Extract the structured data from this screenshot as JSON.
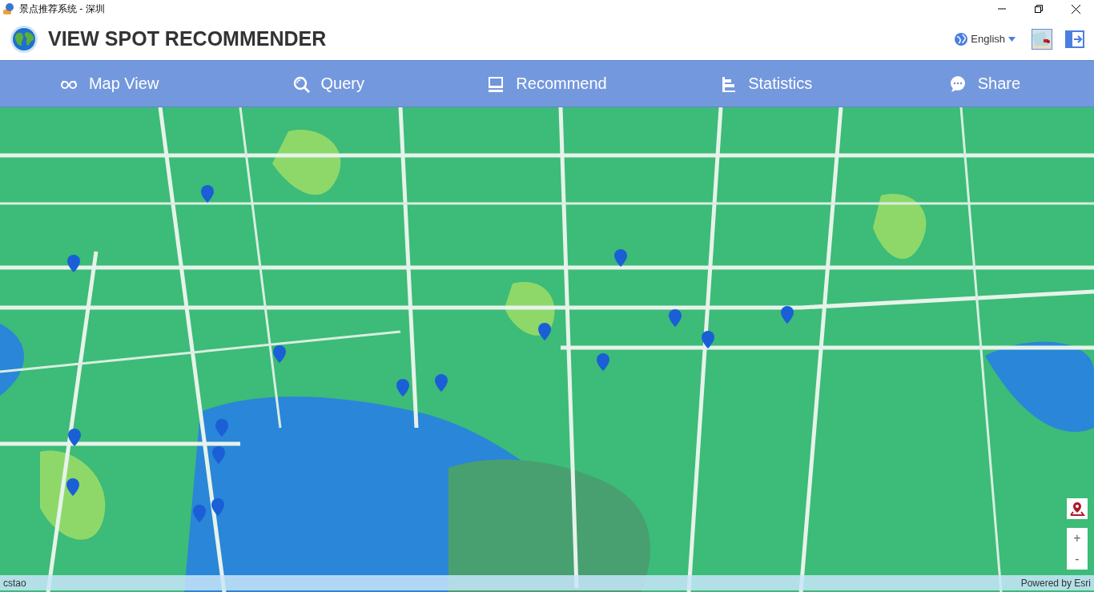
{
  "window": {
    "title": "景点推荐系统 - 深圳"
  },
  "header": {
    "app_title": "VIEW SPOT RECOMMENDER",
    "language": "English"
  },
  "nav": [
    {
      "label": "Map View"
    },
    {
      "label": "Query"
    },
    {
      "label": "Recommend"
    },
    {
      "label": "Statistics"
    },
    {
      "label": "Share"
    }
  ],
  "map": {
    "zoom_in": "+",
    "zoom_out": "-",
    "attribution_left": "cstao",
    "attribution_right": "Powered by Esri"
  }
}
